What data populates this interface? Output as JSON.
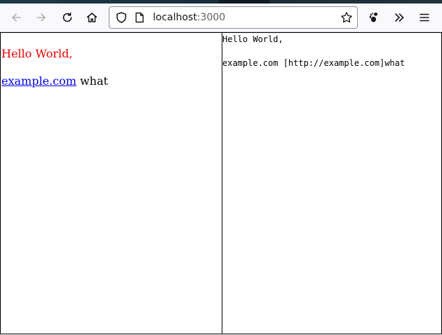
{
  "browser": {
    "url_host": "localhost",
    "url_port": ":3000"
  },
  "left_pane": {
    "greeting": "Hello World,",
    "link_text": "example.com",
    "trailing_text": " what",
    "greeting_color": "#ee0000",
    "link_color": "#0000ee"
  },
  "right_pane": {
    "line1": "Hello World,",
    "line2": "example.com [http://example.com]what"
  },
  "icons": {
    "back": "arrow-left-icon",
    "forward": "arrow-right-icon",
    "reload": "reload-icon",
    "home": "home-icon",
    "tracking": "shield-icon",
    "page": "page-icon",
    "bookmark": "star-icon",
    "extension": "gnome-icon",
    "overflow": "chevrons-right-icon",
    "menu": "hamburger-menu-icon"
  }
}
